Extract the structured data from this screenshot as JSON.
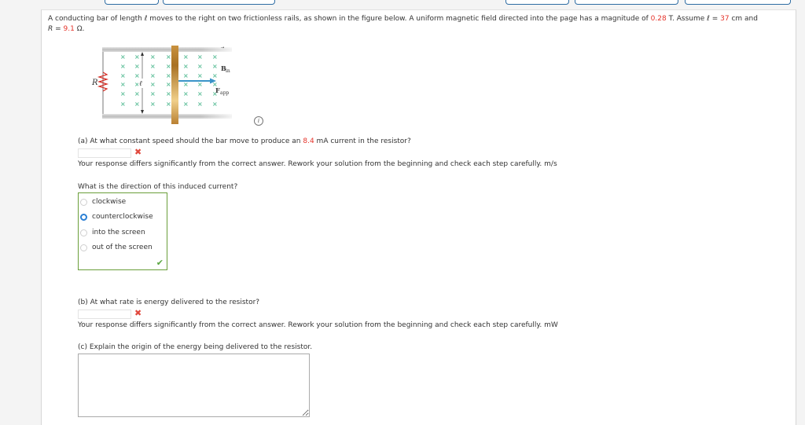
{
  "top_buttons": [
    "",
    "",
    "",
    "",
    ""
  ],
  "problem": {
    "intro_part1": "A conducting bar of length ℓ moves to the right on two frictionless rails, as shown in the figure below. A uniform magnetic field directed into the page has a magnitude of ",
    "B_value": "0.28",
    "intro_part2": " T. Assume ℓ = ",
    "l_value": "37",
    "intro_part3": " cm and",
    "R_label": "R = ",
    "R_value": "9.1",
    "R_unit": " Ω."
  },
  "figure": {
    "resistor_label": "R",
    "length_label": "ℓ",
    "field_label": "B",
    "field_subscript": "in",
    "force_label": "F",
    "force_subscript": "app",
    "info_icon": "i"
  },
  "part_a": {
    "question_part1": "(a) At what constant speed should the bar move to produce an ",
    "current_value": "8.4",
    "question_part2": " mA current in the resistor?",
    "answer_value": "",
    "status_icon": "✖",
    "feedback": "Your response differs significantly from the correct answer. Rework your solution from the beginning and check each step carefully.",
    "unit": "m/s"
  },
  "direction_question": {
    "prompt": "What is the direction of this induced current?",
    "options": [
      "clockwise",
      "counterclockwise",
      "into the screen",
      "out of the screen"
    ],
    "selected": "counterclockwise",
    "status_icon": "✔"
  },
  "part_b": {
    "question": "(b) At what rate is energy delivered to the resistor?",
    "answer_value": "",
    "status_icon": "✖",
    "feedback": "Your response differs significantly from the correct answer. Rework your solution from the beginning and check each step carefully.",
    "unit": "mW"
  },
  "part_c": {
    "question": "(c) Explain the origin of the energy being delivered to the resistor.",
    "answer_value": ""
  }
}
